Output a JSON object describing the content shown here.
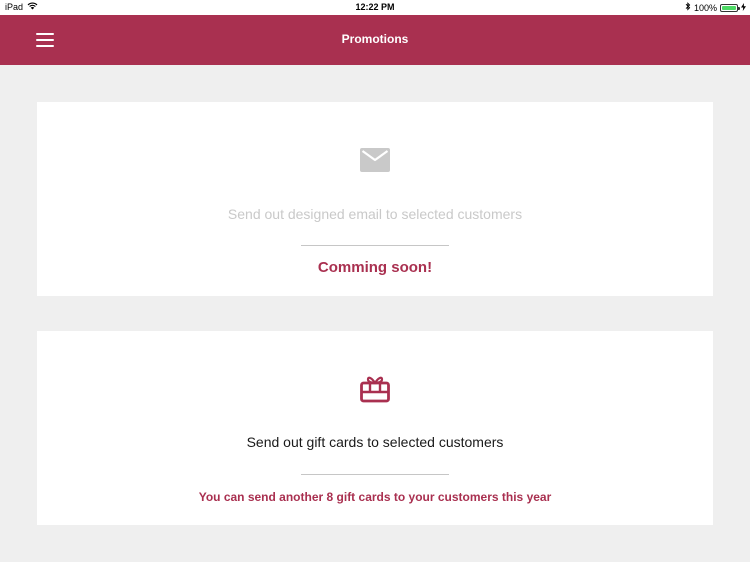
{
  "status_bar": {
    "device": "iPad",
    "time": "12:22 PM",
    "battery": "100%",
    "battery_level": 1.0
  },
  "navbar": {
    "title": "Promotions"
  },
  "email_card": {
    "icon": "envelope-icon",
    "description": "Send out designed email to selected customers",
    "note": "Comming soon!"
  },
  "gift_card": {
    "icon": "gift-card-icon",
    "description": "Send out gift cards to selected customers",
    "note": "You can send another 8 gift cards to your customers this year"
  },
  "colors": {
    "accent": "#a93050",
    "background": "#efefef",
    "disabled_text": "#c9c9c9"
  }
}
